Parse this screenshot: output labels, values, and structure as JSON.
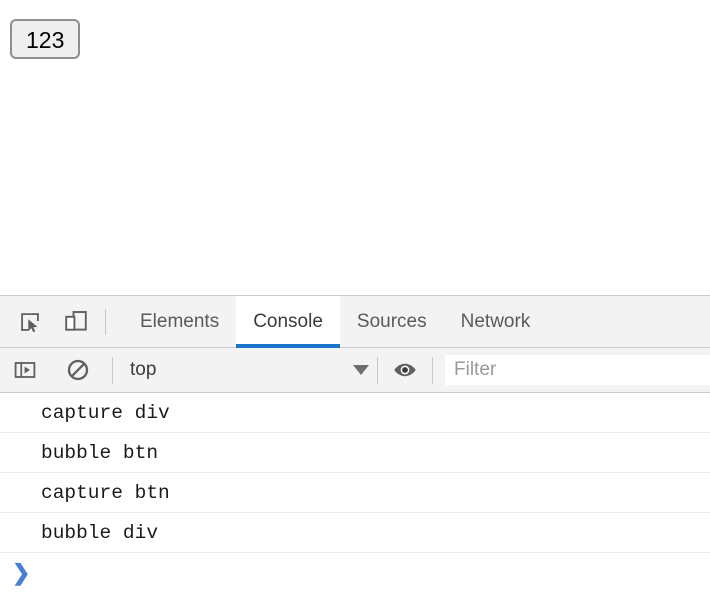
{
  "page": {
    "button_label": "123"
  },
  "devtools": {
    "toolbar_icons": [
      {
        "name": "inspect-element-icon",
        "title": "Inspect"
      },
      {
        "name": "device-toolbar-icon",
        "title": "Toggle device toolbar"
      }
    ],
    "tabs": [
      {
        "label": "Elements",
        "active": false
      },
      {
        "label": "Console",
        "active": true
      },
      {
        "label": "Sources",
        "active": false
      },
      {
        "label": "Network",
        "active": false
      }
    ],
    "active_tab": "Console",
    "accent_color": "#1a73c8",
    "console_toolbar": {
      "sidebar_toggle_icon": "console-sidebar-toggle-icon",
      "clear_console_icon": "clear-console-icon",
      "context_label": "top",
      "context_caret_icon": "chevron-down-icon",
      "live_expression_icon": "eye-icon",
      "filter_placeholder": "Filter",
      "filter_value": ""
    },
    "console_messages": [
      {
        "text": "capture div"
      },
      {
        "text": "bubble btn"
      },
      {
        "text": "capture btn"
      },
      {
        "text": "bubble div"
      }
    ],
    "prompt": {
      "chevron": "❯",
      "value": ""
    }
  }
}
